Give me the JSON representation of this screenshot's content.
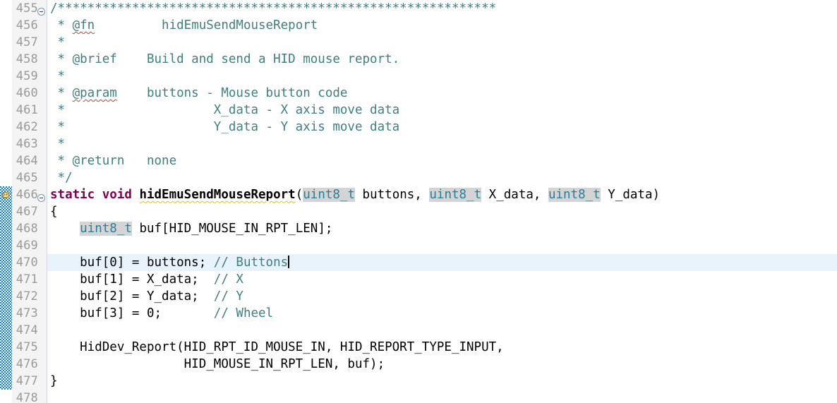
{
  "editor": {
    "kind": "eclipse-cdt-c-source-editor",
    "first_line": 455,
    "last_line": 478,
    "line_height": 24,
    "current_line": 470,
    "colors": {
      "background": "#ffffff",
      "gutter_background": "#f4f4f4",
      "line_number": "#9a9a9a",
      "current_line_highlight": "#e8f2fb",
      "comment": "#3f7f7f",
      "keyword": "#7f0055",
      "type_identifier": "#267f99",
      "occurrence_highlight": "#d4d4d4",
      "annotation_bar": "#1a7fd4",
      "spell_squiggle": "#d23c2a",
      "warning_squiggle": "#e8c400"
    }
  },
  "gutter": {
    "line_numbers": [
      "455",
      "456",
      "457",
      "458",
      "459",
      "460",
      "461",
      "462",
      "463",
      "464",
      "465",
      "466",
      "467",
      "468",
      "469",
      "470",
      "471",
      "472",
      "473",
      "474",
      "475",
      "476",
      "477",
      "478"
    ],
    "fold_markers": [
      {
        "line": 455,
        "state": "expanded",
        "glyph": "minus-circle"
      },
      {
        "line": 466,
        "state": "expanded",
        "glyph": "minus-circle"
      }
    ],
    "markers": [
      {
        "line": 466,
        "icon": "task-marker-icon",
        "title": "marker"
      }
    ],
    "annotation_band": {
      "from_line": 466,
      "to_line": 477
    }
  },
  "code": {
    "lines": [
      {
        "n": "455",
        "text": "/***********************************************************"
      },
      {
        "n": "456",
        "text": " * @fn         hidEmuSendMouseReport"
      },
      {
        "n": "457",
        "text": " *"
      },
      {
        "n": "458",
        "text": " * @brief    Build and send a HID mouse report."
      },
      {
        "n": "459",
        "text": " *"
      },
      {
        "n": "460",
        "text": " * @param    buttons - Mouse button code"
      },
      {
        "n": "461",
        "text": " *                    X_data - X axis move data"
      },
      {
        "n": "462",
        "text": " *                    Y_data - Y axis move data"
      },
      {
        "n": "463",
        "text": " *"
      },
      {
        "n": "464",
        "text": " * @return   none"
      },
      {
        "n": "465",
        "text": " */"
      },
      {
        "n": "466",
        "text": "static void hidEmuSendMouseReport(uint8_t buttons, uint8_t X_data, uint8_t Y_data)"
      },
      {
        "n": "467",
        "text": "{"
      },
      {
        "n": "468",
        "text": "    uint8_t buf[HID_MOUSE_IN_RPT_LEN];"
      },
      {
        "n": "469",
        "text": ""
      },
      {
        "n": "470",
        "text": "    buf[0] = buttons; // Buttons"
      },
      {
        "n": "471",
        "text": "    buf[1] = X_data;  // X"
      },
      {
        "n": "472",
        "text": "    buf[2] = Y_data;  // Y"
      },
      {
        "n": "473",
        "text": "    buf[3] = 0;       // Wheel"
      },
      {
        "n": "474",
        "text": ""
      },
      {
        "n": "475",
        "text": "    HidDev_Report(HID_RPT_ID_MOUSE_IN, HID_REPORT_TYPE_INPUT,"
      },
      {
        "n": "476",
        "text": "                  HID_MOUSE_IN_RPT_LEN, buf);"
      },
      {
        "n": "477",
        "text": "}"
      },
      {
        "n": "478",
        "text": ""
      }
    ],
    "tokens": {
      "l455_stars": "/***********************************************************",
      "l456_star": " * ",
      "l456_fn": "@fn",
      "l456_gap": "         ",
      "l456_name": "hidEmuSendMouseReport",
      "l457": " *",
      "l458_star": " * ",
      "l458_brief": "@brief",
      "l458_rest": "    Build and send a HID mouse report.",
      "l459": " *",
      "l460_star": " * ",
      "l460_param": "@param",
      "l460_rest": "    buttons - Mouse button code",
      "l461": " *                    X_data - X axis move data",
      "l462": " *                    Y_data - Y axis move data",
      "l463": " *",
      "l464_star": " * ",
      "l464_return": "@return",
      "l464_rest": "   none",
      "l465": " */",
      "l466_kw": "static void ",
      "l466_fname": "hidEmuSendMouseReport",
      "l466_p1": "(",
      "l466_t1": "uint8_t",
      "l466_a1": " buttons, ",
      "l466_t2": "uint8_t",
      "l466_a2": " X_data, ",
      "l466_t3": "uint8_t",
      "l466_a3": " Y_data)",
      "l467": "{",
      "l468_indent": "    ",
      "l468_type": "uint8_t",
      "l468_rest": " buf[HID_MOUSE_IN_RPT_LEN];",
      "l470_code": "    buf[0] = buttons; ",
      "l470_cmt": "// Buttons",
      "l471_code": "    buf[1] = X_data;  ",
      "l471_cmt": "// X",
      "l472_code": "    buf[2] = Y_data;  ",
      "l472_cmt": "// Y",
      "l473_code": "    buf[3] = 0;       ",
      "l473_cmt": "// Wheel",
      "l475": "    HidDev_Report(HID_RPT_ID_MOUSE_IN, HID_REPORT_TYPE_INPUT,",
      "l476": "                  HID_MOUSE_IN_RPT_LEN, buf);",
      "l477": "}",
      "l478": ""
    }
  }
}
